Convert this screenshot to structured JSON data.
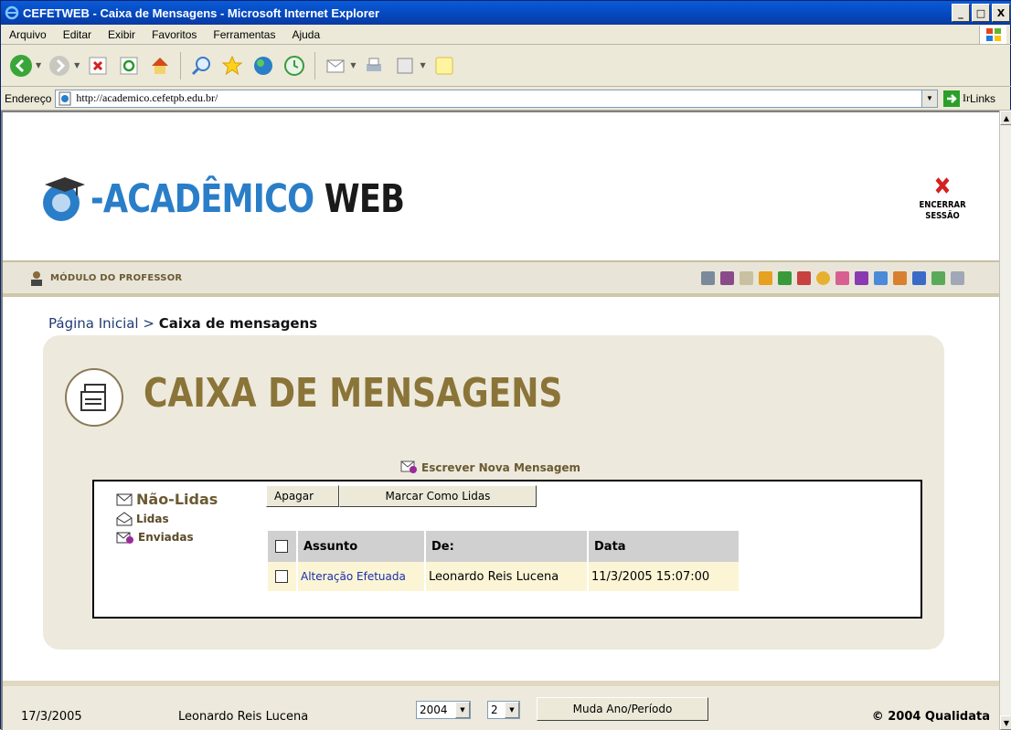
{
  "window": {
    "title": "CEFETWEB - Caixa de Mensagens - Microsoft Internet Explorer",
    "controls": [
      "_",
      "□",
      "X"
    ]
  },
  "menu": [
    "Arquivo",
    "Editar",
    "Exibir",
    "Favoritos",
    "Ferramentas",
    "Ajuda"
  ],
  "address": {
    "label": "Endereço",
    "url": "http://academico.cefetpb.edu.br/",
    "go_label": "Ir",
    "links_label": "Links"
  },
  "header": {
    "logo_accent": "-ACADÊMICO",
    "logo_main": "WEB",
    "end_session_line1": "ENCERRAR",
    "end_session_line2": "SESSÃO",
    "module_label": "MÓDULO DO PROFESSOR"
  },
  "breadcrumb": {
    "home": "Página Inicial",
    "separator": ">",
    "current": "Caixa de mensagens"
  },
  "panel": {
    "title": "CAIXA DE MENSAGENS",
    "new_message": "Escrever Nova Mensagem"
  },
  "folders": {
    "unread": "Não-Lidas",
    "read": "Lidas",
    "sent": "Enviadas"
  },
  "actions": {
    "delete": "Apagar",
    "mark_read": "Marcar Como Lidas"
  },
  "table": {
    "headers": [
      "Assunto",
      "De:",
      "Data"
    ],
    "rows": [
      {
        "subject": "Alteração Efetuada",
        "from": "Leonardo Reis Lucena",
        "date": "11/3/2005 15:07:00"
      }
    ]
  },
  "footer": {
    "date": "17/3/2005",
    "user": "Leonardo Reis Lucena",
    "year": "2004",
    "period": "2",
    "change_button": "Muda Ano/Período",
    "copyright": "© 2004 Qualidata"
  },
  "colors": {
    "title_bar": "#0a5bd8",
    "logo_accent": "#2a7ec8",
    "panel_title": "#8a7438",
    "link": "#1a2ea8",
    "row_bg": "#fbf5d6"
  }
}
